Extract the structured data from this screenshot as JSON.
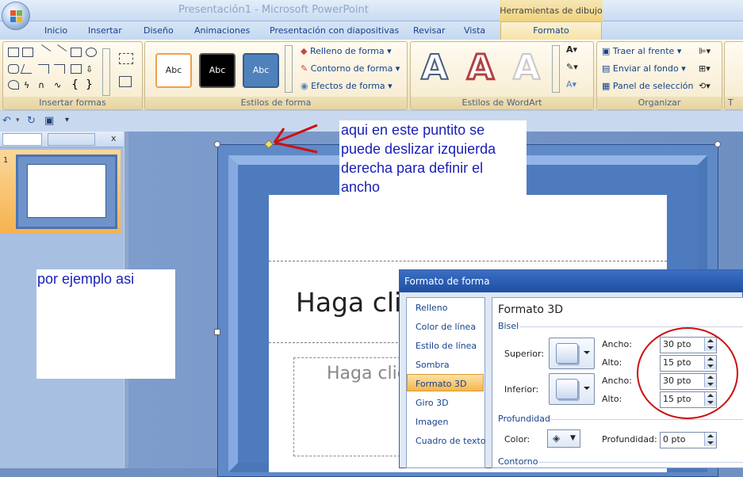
{
  "window": {
    "title": "Presentación1 - Microsoft PowerPoint",
    "context_tab_title": "Herramientas de dibujo"
  },
  "ribbon_tabs": [
    "Inicio",
    "Insertar",
    "Diseño",
    "Animaciones",
    "Presentación con diapositivas",
    "Revisar",
    "Vista",
    "Formato"
  ],
  "ribbon": {
    "groups": {
      "insert_shapes": "Insertar formas",
      "shape_styles": "Estilos de forma",
      "wordart_styles": "Estilos de WordArt",
      "arrange": "Organizar",
      "size_cut": "T"
    },
    "style_thumbs": [
      "Abc",
      "Abc",
      "Abc"
    ],
    "shape_commands": [
      "Relleno de forma",
      "Contorno de forma",
      "Efectos de forma"
    ],
    "arrange_commands": [
      "Traer al frente",
      "Enviar al fondo",
      "Panel de selección"
    ],
    "wordart_letter": "A"
  },
  "slides_panel": {
    "slide_number": "1",
    "close_label": "x"
  },
  "slide": {
    "title_placeholder": "Haga clic",
    "subtitle_placeholder": "Haga clic"
  },
  "annotations": {
    "top_note": "aqui en este puntito se puede deslizar izquierda derecha para definir el ancho",
    "left_note": "por ejemplo asi"
  },
  "dialog": {
    "title": "Formato de forma",
    "nav_items": [
      "Relleno",
      "Color de línea",
      "Estilo de línea",
      "Sombra",
      "Formato 3D",
      "Giro 3D",
      "Imagen",
      "Cuadro de texto"
    ],
    "active_nav": "Formato 3D",
    "section_title": "Formato 3D",
    "bevel_heading": "Bisel",
    "top_label": "Superior:",
    "bottom_label": "Inferior:",
    "width_label": "Ancho:",
    "height_label": "Alto:",
    "top_width": "30 pto",
    "top_height": "15 pto",
    "bottom_width": "30 pto",
    "bottom_height": "15 pto",
    "depth_heading": "Profundidad",
    "color_label": "Color:",
    "depth_label": "Profundidad:",
    "depth_value": "0 pto",
    "contour_heading": "Contorno"
  },
  "colors": {
    "accent_red": "#cc1111",
    "annotation_blue": "#1a20b8",
    "frame_blue": "#5f89c7"
  }
}
